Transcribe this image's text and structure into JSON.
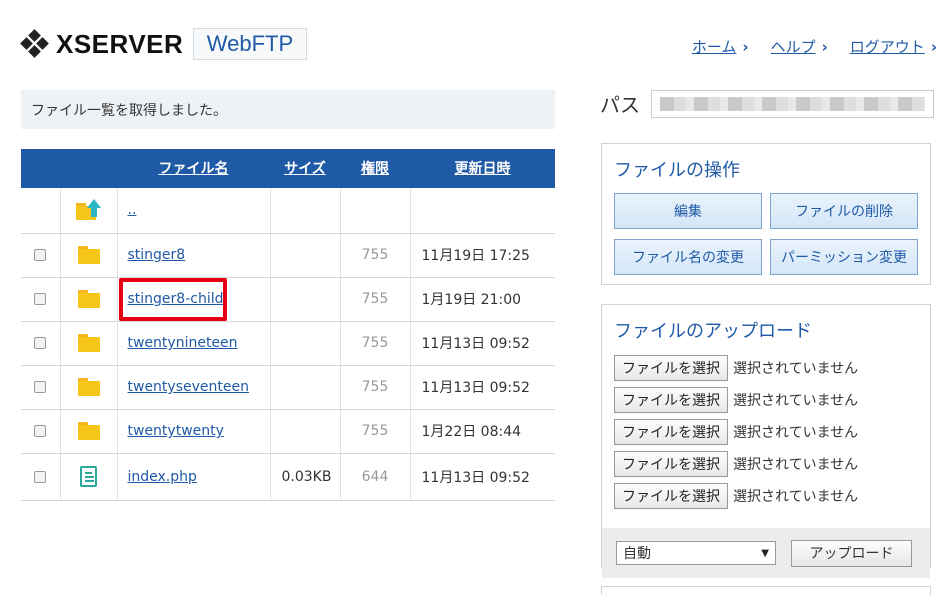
{
  "header": {
    "logo_text": "XSERVER",
    "app_name": "WebFTP",
    "nav": [
      {
        "label": "ホーム"
      },
      {
        "label": "ヘルプ"
      },
      {
        "label": "ログアウト"
      }
    ]
  },
  "message": "ファイル一覧を取得しました。",
  "table": {
    "columns": {
      "name": "ファイル名",
      "size": "サイズ",
      "permission": "権限",
      "modified": "更新日時"
    },
    "parent_link": "..",
    "rows": [
      {
        "name": "stinger8",
        "type": "folder",
        "size": "",
        "permission": "755",
        "modified": "11月19日 17:25"
      },
      {
        "name": "stinger8-child",
        "type": "folder",
        "size": "",
        "permission": "755",
        "modified": "1月19日 21:00"
      },
      {
        "name": "twentynineteen",
        "type": "folder",
        "size": "",
        "permission": "755",
        "modified": "11月13日 09:52"
      },
      {
        "name": "twentyseventeen",
        "type": "folder",
        "size": "",
        "permission": "755",
        "modified": "11月13日 09:52"
      },
      {
        "name": "twentytwenty",
        "type": "folder",
        "size": "",
        "permission": "755",
        "modified": "1月22日 08:44"
      },
      {
        "name": "index.php",
        "type": "file",
        "size": "0.03KB",
        "permission": "644",
        "modified": "11月13日 09:52"
      }
    ],
    "highlight_color": "#e60012"
  },
  "path": {
    "label": "パス"
  },
  "operations": {
    "title": "ファイルの操作",
    "buttons": [
      "編集",
      "ファイルの削除",
      "ファイル名の変更",
      "パーミッション変更"
    ]
  },
  "upload": {
    "title": "ファイルのアップロード",
    "choose_label": "ファイルを選択",
    "no_file_label": "選択されていません",
    "slots": 5,
    "encoding_value": "自動",
    "upload_button": "アップロード"
  },
  "colors": {
    "accent": "#1f5aa6",
    "folder": "#f5c518",
    "highlight": "#e60012"
  }
}
